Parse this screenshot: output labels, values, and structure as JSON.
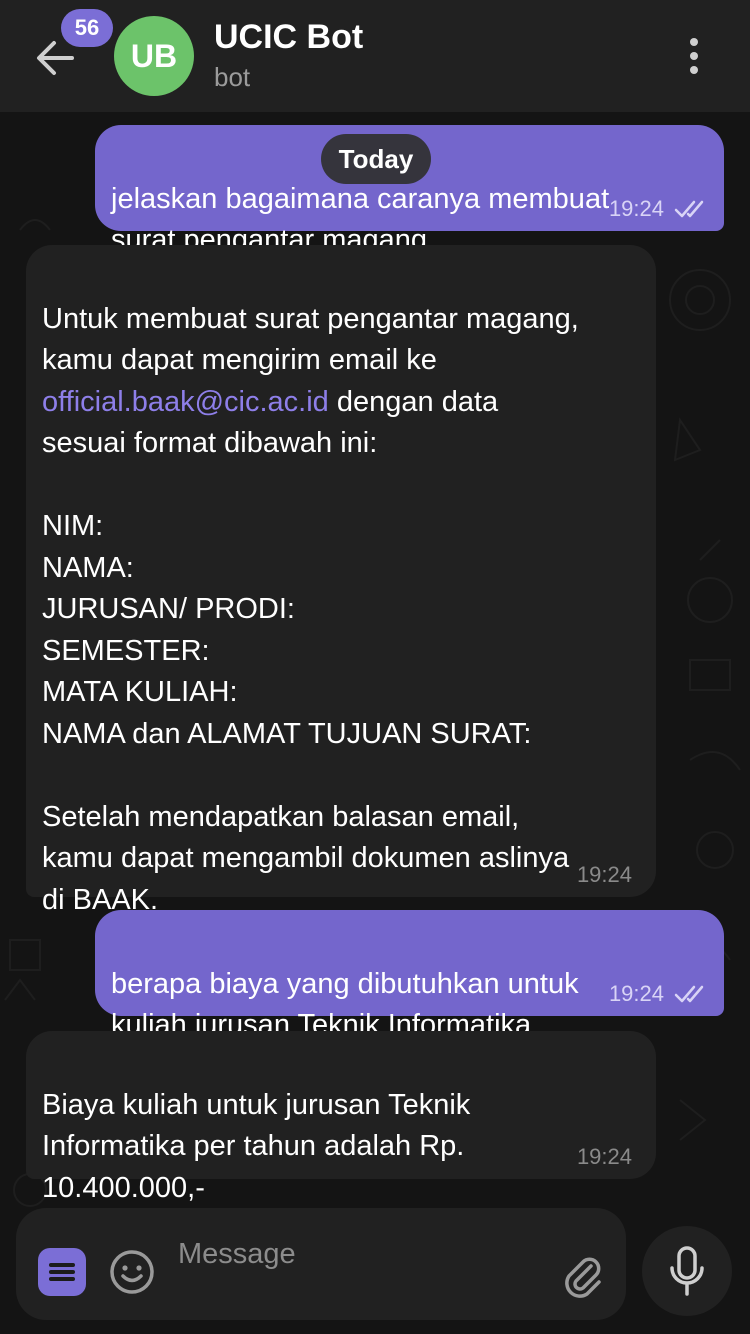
{
  "header": {
    "unread_count": "56",
    "avatar_initials": "UB",
    "title": "UCIC Bot",
    "subtitle": "bot"
  },
  "date_separator": "Today",
  "messages": [
    {
      "direction": "outgoing",
      "text": "jelaskan bagaimana caranya membuat\nsurat pengantar magang",
      "time": "19:24",
      "status": "read"
    },
    {
      "direction": "incoming",
      "text_before_link": "Untuk membuat surat pengantar magang,\nkamu dapat mengirim email ke\n",
      "link": "official.baak@cic.ac.id",
      "text_after_link": " dengan data\nsesuai format dibawah ini:\n\nNIM:\nNAMA:\nJURUSAN/ PRODI:\nSEMESTER:\nMATA KULIAH:\nNAMA dan ALAMAT TUJUAN SURAT:\n\nSetelah mendapatkan balasan email,\nkamu dapat mengambil dokumen aslinya\ndi BAAK.",
      "time": "19:24"
    },
    {
      "direction": "outgoing",
      "text": "berapa biaya yang dibutuhkan untuk\nkuliah jurusan Teknik Informatika",
      "time": "19:24",
      "status": "read"
    },
    {
      "direction": "incoming",
      "text": "Biaya kuliah untuk jurusan Teknik\nInformatika per tahun adalah Rp.\n10.400.000,-",
      "time": "19:24"
    }
  ],
  "composer": {
    "placeholder": "Message"
  },
  "colors": {
    "accent": "#7b6ed6",
    "outgoing_bubble": "#7466cc",
    "incoming_bubble": "#212121",
    "avatar": "#6cc36a",
    "link": "#8e7fe9"
  },
  "icons": [
    "back-arrow-icon",
    "more-vertical-icon",
    "double-check-icon",
    "bot-menu-icon",
    "emoji-icon",
    "paperclip-icon",
    "microphone-icon"
  ]
}
